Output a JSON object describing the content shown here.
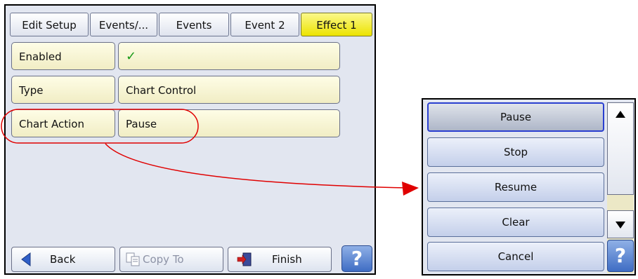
{
  "breadcrumbs": [
    "Edit Setup",
    "Events/...",
    "Events",
    "Event 2",
    "Effect 1"
  ],
  "rows": [
    {
      "label": "Enabled",
      "value": "✓"
    },
    {
      "label": "Type",
      "value": "Chart Control"
    },
    {
      "label": "Chart Action",
      "value": "Pause"
    }
  ],
  "footer": {
    "back": "Back",
    "copy_to": "Copy To",
    "finish": "Finish",
    "help": "?"
  },
  "popup": {
    "options": [
      "Pause",
      "Stop",
      "Resume",
      "Clear",
      "Cancel"
    ],
    "selected": "Pause",
    "help": "?"
  },
  "colors": {
    "active_crumb": "#f0e800",
    "callout": "#e00000",
    "selected_outline": "#2a3fd0",
    "check": "#1a9a1a"
  }
}
